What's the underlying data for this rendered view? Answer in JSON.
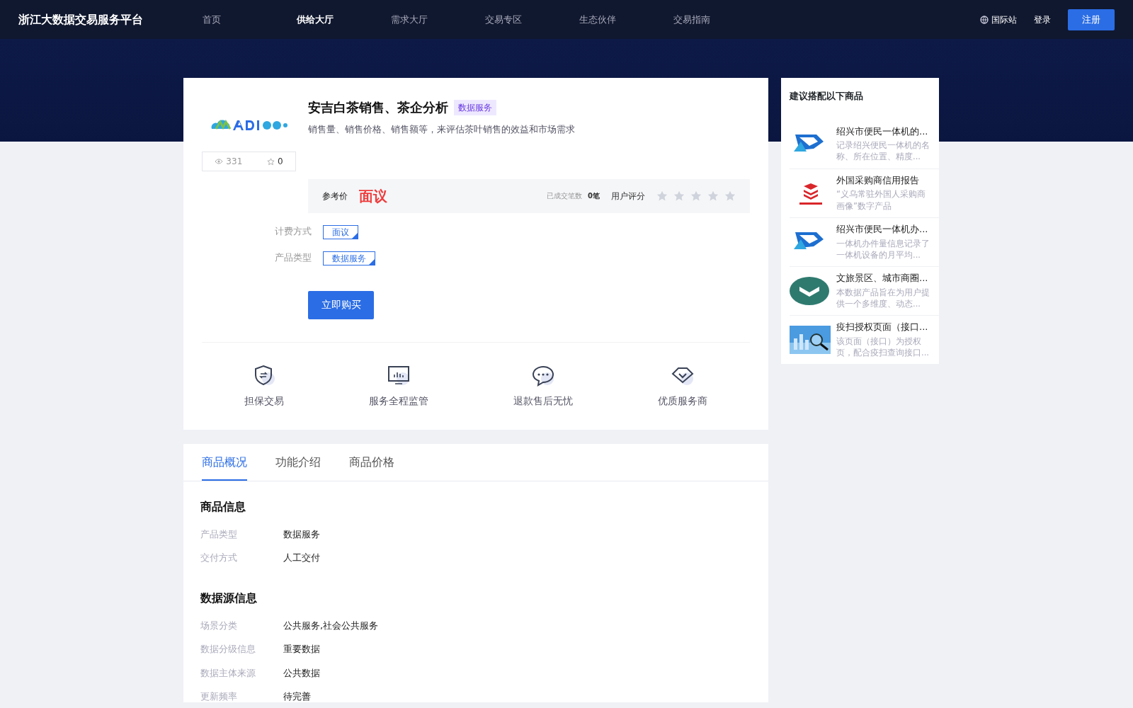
{
  "header": {
    "brand": "浙江大数据交易服务平台",
    "nav": [
      {
        "label": "首页",
        "selected": false
      },
      {
        "label": "供给大厅",
        "selected": true
      },
      {
        "label": "需求大厅",
        "selected": false
      },
      {
        "label": "交易专区",
        "selected": false
      },
      {
        "label": "生态伙伴",
        "selected": false
      },
      {
        "label": "交易指南",
        "selected": false
      }
    ],
    "intl": "国际站",
    "login": "登录",
    "register": "注册"
  },
  "product": {
    "title": "安吉白茶销售、茶企分析",
    "tag": "数据服务",
    "description": "销售量、销售价格、销售额等，来评估茶叶销售的效益和市场需求",
    "views": "331",
    "favorites": "0",
    "price_label": "参考价",
    "price": "面议",
    "deals_label": "已成交笔数",
    "deals": "0笔",
    "rating_label": "用户评分",
    "stars": 0,
    "options": [
      {
        "label": "计费方式",
        "value": "面议"
      },
      {
        "label": "产品类型",
        "value": "数据服务"
      }
    ],
    "buy": "立即购买",
    "guarantees": [
      {
        "kind": "shield",
        "label": "担保交易"
      },
      {
        "kind": "monitor",
        "label": "服务全程监管"
      },
      {
        "kind": "chat",
        "label": "退款售后无忧"
      },
      {
        "kind": "diamond",
        "label": "优质服务商"
      }
    ]
  },
  "tabs": [
    {
      "label": "商品概况",
      "selected": true
    },
    {
      "label": "功能介绍",
      "selected": false
    },
    {
      "label": "商品价格",
      "selected": false
    }
  ],
  "sections": [
    {
      "title": "商品信息",
      "rows": [
        {
          "label": "产品类型",
          "value": "数据服务"
        },
        {
          "label": "交付方式",
          "value": "人工交付"
        }
      ]
    },
    {
      "title": "数据源信息",
      "rows": [
        {
          "label": "场景分类",
          "value": "公共服务,社会公共服务"
        },
        {
          "label": "数据分级信息",
          "value": "重要数据"
        },
        {
          "label": "数据主体来源",
          "value": "公共数据"
        },
        {
          "label": "更新频率",
          "value": "待完善"
        }
      ]
    }
  ],
  "sidebar": {
    "title": "建议搭配以下商品",
    "items": [
      {
        "kind": "diamond-logo",
        "title": "绍兴市便民一体机的...",
        "description": "记录绍兴便民一体机的名称、所在位置、精度..."
      },
      {
        "kind": "stack-logo",
        "title": "外国采购商信用报告",
        "description": "“义乌常驻外国人采购商画像”数字产品"
      },
      {
        "kind": "diamond-logo",
        "title": "绍兴市便民一体机办...",
        "description": "一体机办件量信息记录了一体机设备的月平均..."
      },
      {
        "kind": "circle-logo",
        "title": "文旅景区、城市商圈...",
        "description": "本数据产品旨在为用户提供一个多维度、动态..."
      },
      {
        "kind": "picture",
        "title": "疫扫授权页面（接口...",
        "description": "该页面（接口）为授权页，配合疫扫查询接口..."
      }
    ]
  }
}
